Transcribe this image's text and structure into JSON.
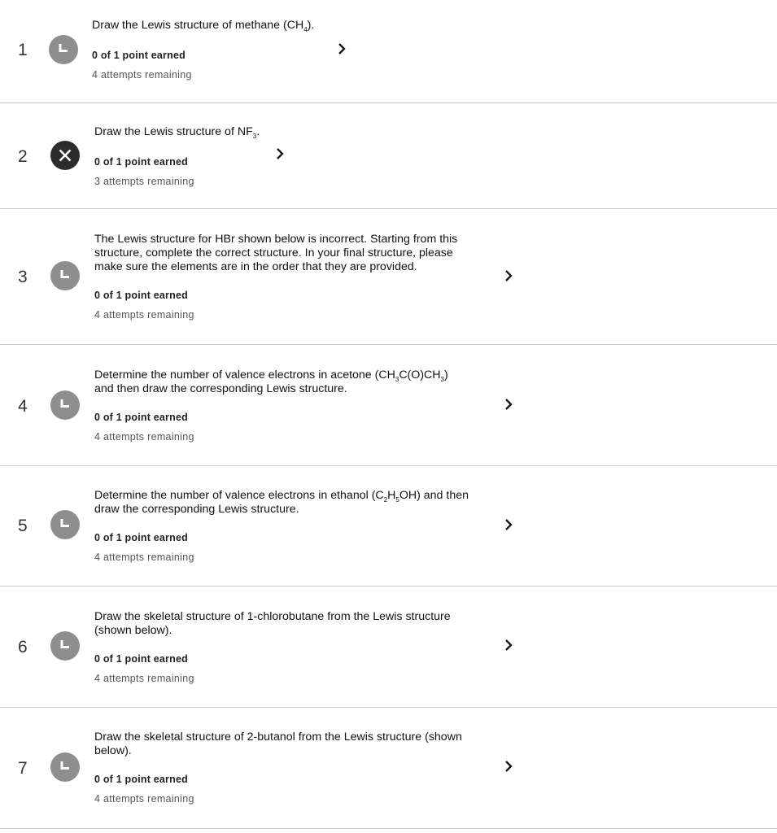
{
  "questions": [
    {
      "number": "1",
      "status": "clock-icon",
      "prompt_parts": [
        "Draw the Lewis structure of methane (CH",
        "4",
        ")."
      ],
      "points": "0 of 1 point earned",
      "attempts": "4 attempts remaining"
    },
    {
      "number": "2",
      "status": "x-icon",
      "prompt_parts": [
        "Draw the Lewis structure of NF",
        "3",
        "."
      ],
      "points": "0 of 1 point earned",
      "attempts": "3 attempts remaining"
    },
    {
      "number": "3",
      "status": "clock-icon",
      "prompt_lines": [
        "The Lewis structure for HBr shown below is incorrect. Starting from this",
        "structure, complete the correct structure. In your final structure, please",
        "make sure the elements are in the order that they are provided."
      ],
      "points": "0 of 1 point earned",
      "attempts": "4 attempts remaining"
    },
    {
      "number": "4",
      "status": "clock-icon",
      "prompt_parts": [
        "Determine the number of valence electrons in acetone (CH",
        "3",
        "C(O)CH",
        "3",
        ")",
        "and then draw the corresponding Lewis structure."
      ],
      "points": "0 of 1 point earned",
      "attempts": "4 attempts remaining"
    },
    {
      "number": "5",
      "status": "clock-icon",
      "prompt_parts": [
        "Determine the number of valence electrons in ethanol (C",
        "2",
        "H",
        "5",
        "OH) and then",
        "draw the corresponding Lewis structure."
      ],
      "points": "0 of 1 point earned",
      "attempts": "4 attempts remaining"
    },
    {
      "number": "6",
      "status": "clock-icon",
      "prompt_lines": [
        "Draw the skeletal structure of 1-chlorobutane from the Lewis structure",
        "(shown below)."
      ],
      "points": "0 of 1 point earned",
      "attempts": "4 attempts remaining"
    },
    {
      "number": "7",
      "status": "clock-icon",
      "prompt_lines": [
        "Draw the skeletal structure of 2-butanol from the Lewis structure (shown",
        "below)."
      ],
      "points": "0 of 1 point earned",
      "attempts": "4 attempts remaining"
    }
  ],
  "chevron_icon": "chevron-right-icon",
  "colors": {
    "pending_status": "#8e8e8e",
    "incorrect_status": "#2b2b2b",
    "divider": "#c9c9c9"
  }
}
